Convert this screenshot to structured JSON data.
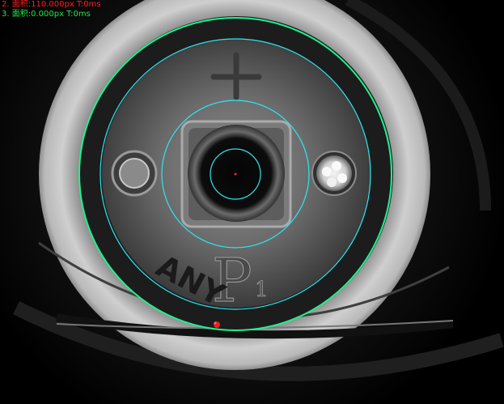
{
  "overlay": {
    "lines": [
      {
        "text": "2. 面积:110.000px  T:0ms",
        "color": "#ff2020"
      },
      {
        "text": "3. 面积:0.000px  T:0ms",
        "color": "#22e84a"
      }
    ]
  },
  "part_marking": {
    "embossed_letter": "P",
    "embossed_subscript": "1",
    "handwritten": "ANY"
  },
  "colors": {
    "outer_ring": "#1ff28f",
    "inspection_rings": "#2be6f0",
    "defect_marker": "#ff2020",
    "background": "#000000"
  },
  "icons": [
    "plus-emboss-icon",
    "left-indicator-icon",
    "right-indicator-icon",
    "center-marker-icon"
  ]
}
